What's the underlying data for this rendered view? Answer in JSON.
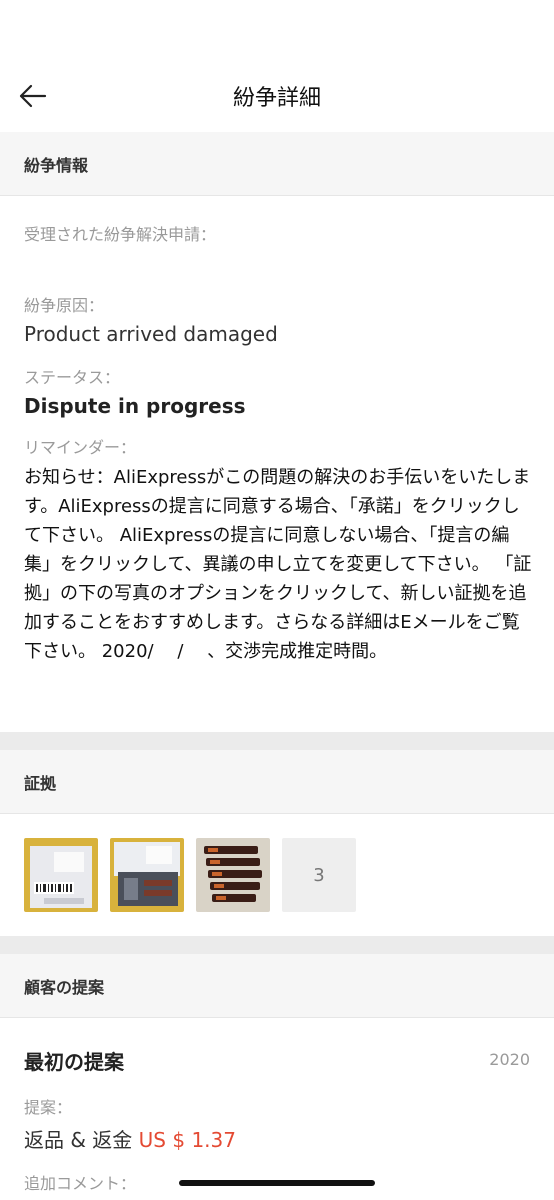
{
  "header": {
    "title": "紛争詳細",
    "back_icon": "back-arrow-icon"
  },
  "dispute_info": {
    "section_title": "紛争情報",
    "accepted_label": "受理された紛争解決申請：",
    "reason_label": "紛争原因：",
    "reason_value": "Product arrived damaged",
    "status_label": "ステータス：",
    "status_value": "Dispute in progress",
    "reminder_label": "リマインダー：",
    "reminder_text": "お知らせ：AliExpressがこの問題の解決のお手伝いをいたします。AliExpressの提言に同意する場合、「承諾」をクリックして下さい。 AliExpressの提言に同意しない場合、「提言の編集」をクリックして、異議の申し立てを変更して下さい。 「証拠」の下の写真のオプションをクリックして、新しい証拠を追加することをおすすめします。さらなる詳細はEメールをご覧下さい。 2020/　 /　 、交渉完成推定時間。"
  },
  "evidence": {
    "section_title": "証拠",
    "more_count": "3"
  },
  "customer_proposal": {
    "section_title": "顧客の提案",
    "first_title": "最初の提案",
    "year": "2020",
    "proposal_label": "提案：",
    "proposal_value": "返品 & 返金",
    "proposal_price": "US $ 1.37",
    "comment_label": "追加コメント："
  },
  "colors": {
    "accent_price": "#e44a33",
    "section_bg": "#f6f6f6",
    "gap_bg": "#ebebeb"
  }
}
